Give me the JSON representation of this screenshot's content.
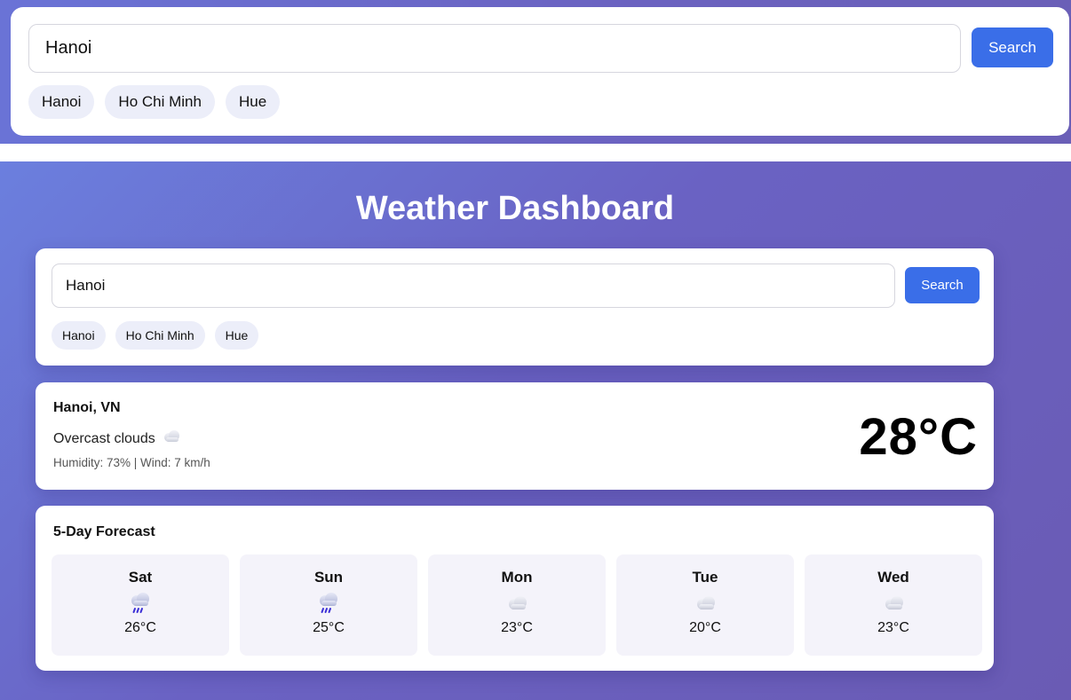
{
  "top": {
    "search": {
      "value": "Hanoi",
      "button_label": "Search"
    },
    "chips": [
      "Hanoi",
      "Ho Chi Minh",
      "Hue"
    ]
  },
  "dashboard": {
    "title": "Weather Dashboard",
    "search": {
      "value": "Hanoi",
      "button_label": "Search"
    },
    "chips": [
      "Hanoi",
      "Ho Chi Minh",
      "Hue"
    ],
    "current": {
      "location": "Hanoi, VN",
      "description": "Overcast clouds",
      "icon": "cloud-icon",
      "details": "Humidity: 73%  |  Wind: 7 km/h",
      "temperature": "28°C"
    },
    "forecast": {
      "title": "5-Day Forecast",
      "days": [
        {
          "day": "Sat",
          "icon": "rain-icon",
          "temp": "26°C"
        },
        {
          "day": "Sun",
          "icon": "rain-icon",
          "temp": "25°C"
        },
        {
          "day": "Mon",
          "icon": "cloud-icon",
          "temp": "23°C"
        },
        {
          "day": "Tue",
          "icon": "cloud-icon",
          "temp": "20°C"
        },
        {
          "day": "Wed",
          "icon": "cloud-icon",
          "temp": "23°C"
        }
      ]
    }
  },
  "colors": {
    "accent": "#3a6ee8",
    "gradient_start": "#6b7fde",
    "gradient_end": "#6a5bb4",
    "chip_bg": "#eceef9"
  }
}
